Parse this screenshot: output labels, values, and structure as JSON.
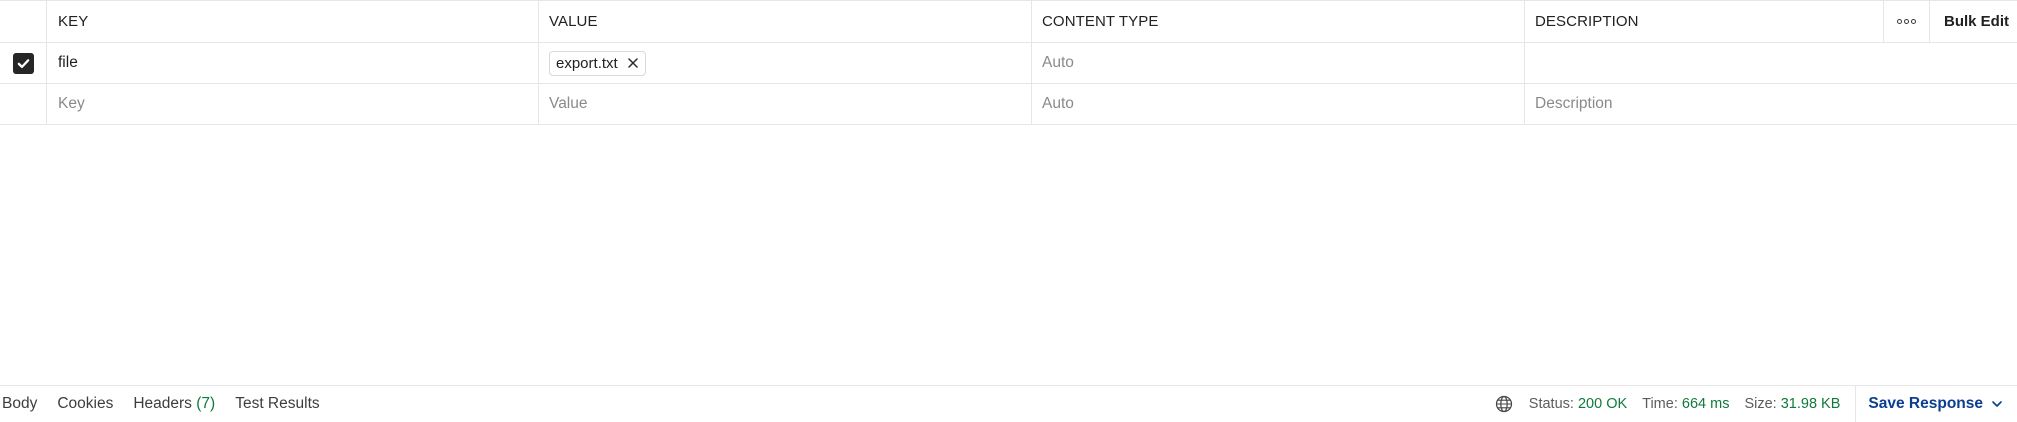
{
  "table": {
    "headers": {
      "key": "KEY",
      "value": "VALUE",
      "content_type": "CONTENT TYPE",
      "description": "DESCRIPTION",
      "bulk_edit": "Bulk Edit"
    },
    "rows": [
      {
        "checked": true,
        "key": "file",
        "value_file": "export.txt",
        "content_type_placeholder": "Auto",
        "description": ""
      }
    ],
    "new_row": {
      "key_placeholder": "Key",
      "value_placeholder": "Value",
      "content_type_placeholder": "Auto",
      "description_placeholder": "Description"
    }
  },
  "response_tabs": [
    {
      "label": "Body"
    },
    {
      "label": "Cookies"
    },
    {
      "label": "Headers",
      "count": "(7)"
    },
    {
      "label": "Test Results"
    }
  ],
  "response_meta": {
    "status_label": "Status:",
    "status_value": "200 OK",
    "time_label": "Time:",
    "time_value": "664 ms",
    "size_label": "Size:",
    "size_value": "31.98 KB"
  },
  "save_response": {
    "label": "Save Response"
  },
  "icons": {
    "checkbox": "check-icon",
    "more": "more-horizontal-icon",
    "remove_file": "close-icon",
    "network": "globe-icon",
    "save_dropdown": "chevron-down-icon"
  },
  "colors": {
    "status_green": "#0f7a3b",
    "save_blue": "#0b3d91",
    "checkbox_dark": "#262626"
  }
}
